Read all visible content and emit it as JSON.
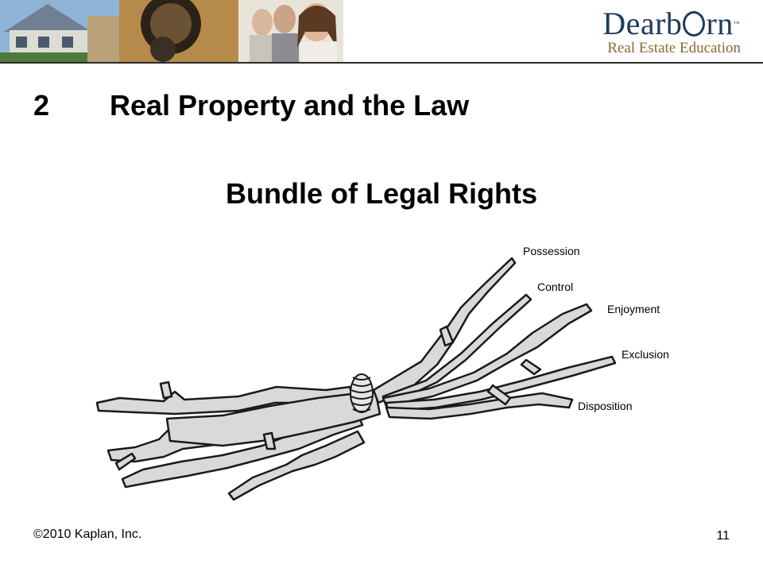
{
  "header": {
    "logo_main": "Dearb",
    "logo_main_rest": "rn",
    "logo_tm": "™",
    "logo_sub": "Real Estate Education"
  },
  "slide": {
    "number": "2",
    "title": "Real Property and the Law",
    "subtitle": "Bundle of Legal Rights"
  },
  "diagram": {
    "labels": [
      "Possession",
      "Control",
      "Enjoyment",
      "Exclusion",
      "Disposition"
    ]
  },
  "footer": {
    "copyright": "©2010 Kaplan, Inc.",
    "page_number": "11"
  },
  "colors": {
    "stick_fill": "#d9d9d9",
    "stick_stroke": "#1a1a1a",
    "logo_blue": "#1f3b5c",
    "logo_gold": "#8a6a2e"
  }
}
